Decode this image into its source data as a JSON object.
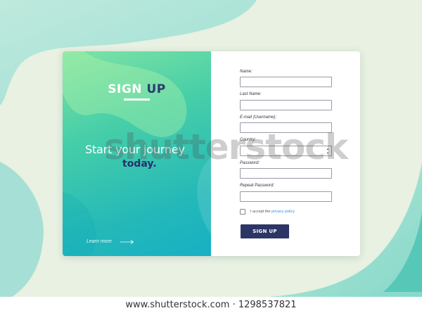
{
  "left_panel": {
    "title_part1": "SIGN ",
    "title_part2": "UP",
    "tagline": "Start your journey",
    "tagline_accent": "today.",
    "learn_more": "Learn more",
    "arrow_icon": "arrow-right-icon"
  },
  "form": {
    "fields": [
      {
        "label": "Name:",
        "value": ""
      },
      {
        "label": "Last Name:",
        "value": ""
      },
      {
        "label": "E-mail (Username):",
        "value": ""
      },
      {
        "label": "Country:",
        "value": ""
      },
      {
        "label": "Password:",
        "value": ""
      },
      {
        "label": "Repeat Password:",
        "value": ""
      }
    ],
    "accept_prefix": "I accept the ",
    "accept_link": "privacy policy",
    "submit_label": "SIGN UP"
  },
  "watermark": "shutterstock",
  "footer": "www.shutterstock.com · 1298537821",
  "colors": {
    "background": "#e8f1e2",
    "accent_mint": "#7fe3a4",
    "accent_teal": "#17b0c6",
    "button": "#2c3566",
    "link": "#3a8ee0"
  }
}
